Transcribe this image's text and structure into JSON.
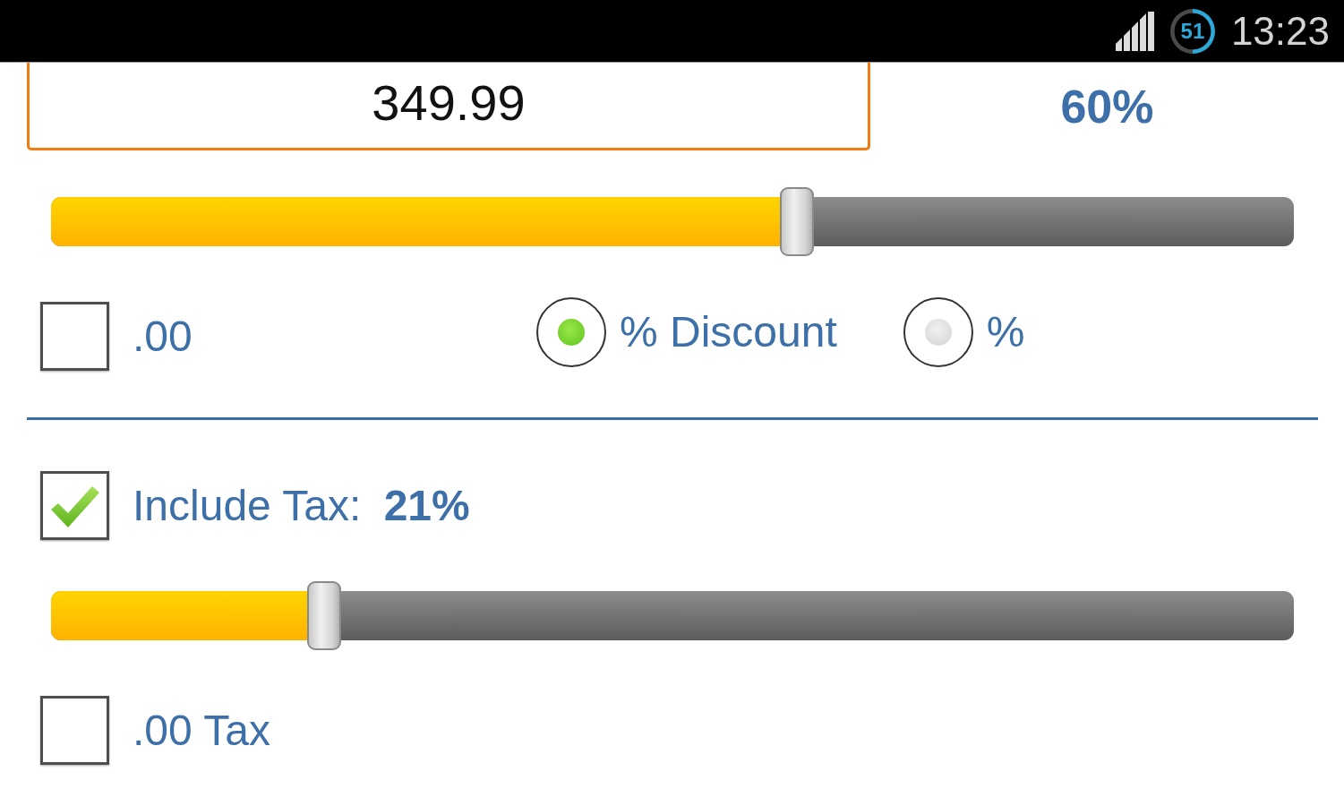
{
  "status_bar": {
    "battery": "51",
    "time": "13:23"
  },
  "price": {
    "value": "349.99"
  },
  "discount": {
    "reading": "60%",
    "level": 0.6,
    "round": {
      "label": ".00",
      "checked": false
    },
    "modes": [
      {
        "label": "% Discount",
        "selected": true
      },
      {
        "label": "%",
        "selected": false
      }
    ]
  },
  "tax": {
    "include": {
      "label": "Include Tax: **21%**",
      "checked": true
    },
    "level": 0.22,
    "round": {
      "label": ".00 Tax",
      "checked": false
    }
  }
}
